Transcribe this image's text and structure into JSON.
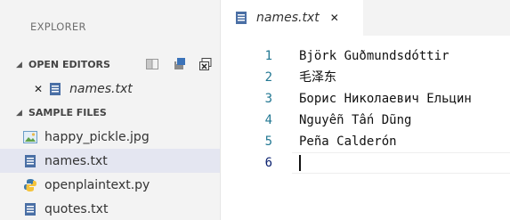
{
  "sidebar": {
    "title": "EXPLORER",
    "open_editors": {
      "header": "OPEN EDITORS",
      "items": [
        {
          "label": "names.txt"
        }
      ]
    },
    "sample_files": {
      "header": "SAMPLE FILES",
      "files": [
        {
          "label": "happy_pickle.jpg",
          "icon": "image-file-icon"
        },
        {
          "label": "names.txt",
          "icon": "text-file-icon",
          "selected": true
        },
        {
          "label": "openplaintext.py",
          "icon": "python-file-icon"
        },
        {
          "label": "quotes.txt",
          "icon": "text-file-icon"
        }
      ]
    }
  },
  "editor": {
    "tab": {
      "label": "names.txt",
      "close": "✕"
    },
    "lines": [
      {
        "num": "1",
        "text": "Björk Guðmundsdóttir"
      },
      {
        "num": "2",
        "text": "毛泽东"
      },
      {
        "num": "3",
        "text": "Борис Николаевич Ельцин"
      },
      {
        "num": "4",
        "text": "Nguyễn Tấn Dũng"
      },
      {
        "num": "5",
        "text": "Peña Calderón"
      },
      {
        "num": "6",
        "text": ""
      }
    ]
  },
  "colors": {
    "accent": "#237893",
    "selection": "#e4e6f1",
    "file_icon": "#4a6fa5"
  }
}
